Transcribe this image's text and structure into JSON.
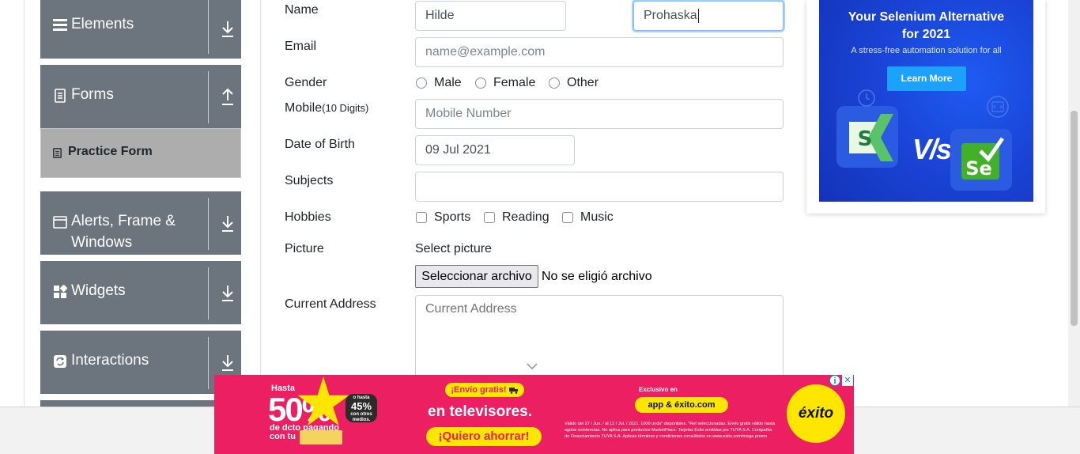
{
  "sidebar": {
    "elements": "Elements",
    "forms": "Forms",
    "practice_form": "Practice Form",
    "alerts_line1": "Alerts, Frame &",
    "alerts_line2": "Windows",
    "widgets": "Widgets",
    "interactions": "Interactions"
  },
  "form": {
    "name_label": "Name",
    "first_name_value": "Hilde",
    "last_name_value": "Prohaska",
    "email_label": "Email",
    "email_placeholder": "name@example.com",
    "gender_label": "Gender",
    "gender_options": [
      "Male",
      "Female",
      "Other"
    ],
    "mobile_label": "Mobile",
    "mobile_hint": "(10 Digits)",
    "mobile_placeholder": "Mobile Number",
    "dob_label": "Date of Birth",
    "dob_value": "09 Jul 2021",
    "subjects_label": "Subjects",
    "hobbies_label": "Hobbies",
    "hobbies_options": [
      "Sports",
      "Reading",
      "Music"
    ],
    "picture_label": "Picture",
    "select_picture": "Select picture",
    "file_button": "Seleccionar archivo",
    "file_status": "No se eligió archivo",
    "address_label": "Current Address",
    "address_placeholder": "Current Address"
  },
  "ad_right": {
    "title_line1": "Your Selenium Alternative",
    "title_line2": "for 2021",
    "subtitle": "A stress-free automation solution for all",
    "cta": "Learn More",
    "vs": "V/s"
  },
  "ad_bottom": {
    "hasta": "Hasta",
    "percent": "50%",
    "de_dcto": "de dcto pagando",
    "con_tu": "con tu",
    "o_hasta": "o hasta",
    "pct45": "45%",
    "con_otros": "con otros medios.",
    "envio": "¡Envío gratis!",
    "televisores": "en televisores.",
    "quiero": "¡Quiero ahorrar!",
    "exclusivo": "Exclusivo en",
    "app": "app & éxito.com",
    "legal": "Válido del 27 / Jun. / al 13 / Jul. / 2021. 1000 unds* disponibles. *Ref seleccionadas. Envío gratis válido hasta agotar existencias. No aplica para productos MarketPlace. Tarjetas Éxito emitidas por TUYA S.A. Compañía de Financiamiento TUYA S.A. Aplican términos y condiciones consúltelos en www.exito.com/mega promo",
    "brand": "éxito",
    "close": "✕",
    "info": "i"
  },
  "colors": {
    "sidebar_bg": "#6c757d",
    "practice_bg": "#adadad",
    "ad_pink": "#ec1f63",
    "ad_blue": "#1a45d8",
    "focus_border": "#80bdff"
  }
}
